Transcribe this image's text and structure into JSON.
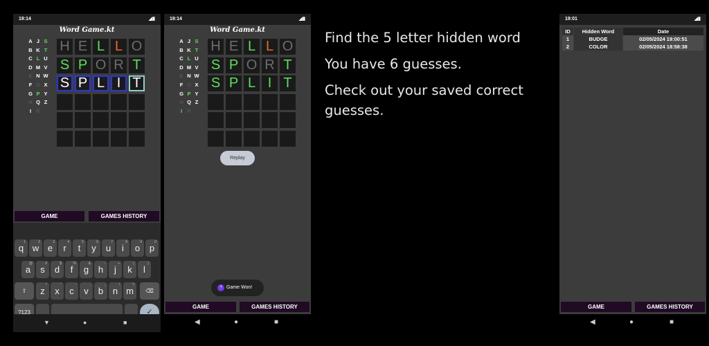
{
  "caption": {
    "line1": "Find the 5 letter hidden word",
    "line2": "You have 6 guesses.",
    "line3a": "Check out your saved correct",
    "line3b": "guesses."
  },
  "phone1": {
    "time": "19:14",
    "title": "Word Game.kt",
    "rows": [
      [
        "H",
        "E",
        "L",
        "L",
        "O"
      ],
      [
        "S",
        "P",
        "O",
        "R",
        "T"
      ],
      [
        "S",
        "P",
        "L",
        "I",
        "T"
      ]
    ],
    "tab_game": "GAME",
    "tab_history": "GAMES HISTORY",
    "keyboard": {
      "row1": [
        "q",
        "w",
        "e",
        "r",
        "t",
        "y",
        "u",
        "i",
        "o",
        "p"
      ],
      "row1_hints": [
        "1",
        "2",
        "3",
        "4",
        "5",
        "6",
        "7",
        "8",
        "9",
        "0"
      ],
      "row2": [
        "a",
        "s",
        "d",
        "f",
        "g",
        "h",
        "j",
        "k",
        "l"
      ],
      "row2_hints": [
        "@",
        "#",
        "$",
        "%",
        "&",
        "-",
        "+",
        "(",
        ")"
      ],
      "row3": [
        "z",
        "x",
        "c",
        "v",
        "b",
        "n",
        "m"
      ],
      "row3_hints": [
        "*",
        "\"",
        "'",
        ":",
        ";",
        "!",
        "?"
      ],
      "shift": "⇧",
      "backspace": "⌫",
      "symbols": "?123",
      "comma": ",",
      "period": ".",
      "enter": "✓"
    }
  },
  "phone2": {
    "time": "19:14",
    "title": "Word Game.kt",
    "rows": [
      [
        "H",
        "E",
        "L",
        "L",
        "O"
      ],
      [
        "S",
        "P",
        "O",
        "R",
        "T"
      ],
      [
        "S",
        "P",
        "L",
        "I",
        "T"
      ]
    ],
    "replay": "Replay",
    "toast": "Game Won!",
    "tab_game": "GAME",
    "tab_history": "GAMES HISTORY"
  },
  "phone3": {
    "time": "19:01",
    "headers": [
      "ID",
      "Hidden Word",
      "Date"
    ],
    "rows": [
      {
        "id": "1",
        "word": "BUDGE",
        "date": "02/05/2024 19:00:51"
      },
      {
        "id": "2",
        "word": "COLOR",
        "date": "02/05/2024 18:58:38"
      }
    ],
    "tab_game": "GAME",
    "tab_history": "GAMES HISTORY"
  },
  "alphabet": [
    {
      "l": "A",
      "c": "w"
    },
    {
      "l": "J",
      "c": "w"
    },
    {
      "l": "S",
      "c": "g"
    },
    {
      "l": "B",
      "c": "w"
    },
    {
      "l": "K",
      "c": "w"
    },
    {
      "l": "T",
      "c": "g"
    },
    {
      "l": "C",
      "c": "w"
    },
    {
      "l": "L",
      "c": "g"
    },
    {
      "l": "U",
      "c": "w"
    },
    {
      "l": "D",
      "c": "w"
    },
    {
      "l": "M",
      "c": "w"
    },
    {
      "l": "V",
      "c": "w"
    },
    {
      "l": "E",
      "c": "x"
    },
    {
      "l": "N",
      "c": "w"
    },
    {
      "l": "W",
      "c": "w"
    },
    {
      "l": "F",
      "c": "w"
    },
    {
      "l": "O",
      "c": "x"
    },
    {
      "l": "X",
      "c": "w"
    },
    {
      "l": "G",
      "c": "w"
    },
    {
      "l": "P",
      "c": "g"
    },
    {
      "l": "Y",
      "c": "w"
    },
    {
      "l": "H",
      "c": "x"
    },
    {
      "l": "Q",
      "c": "w"
    },
    {
      "l": "Z",
      "c": "w"
    },
    {
      "l": "I",
      "c": "w"
    },
    {
      "l": "R",
      "c": "x"
    },
    {
      "l": "",
      "c": "w"
    }
  ],
  "alphabet2": [
    {
      "l": "A",
      "c": "w"
    },
    {
      "l": "J",
      "c": "w"
    },
    {
      "l": "S",
      "c": "g"
    },
    {
      "l": "B",
      "c": "w"
    },
    {
      "l": "K",
      "c": "w"
    },
    {
      "l": "T",
      "c": "g"
    },
    {
      "l": "C",
      "c": "w"
    },
    {
      "l": "L",
      "c": "g"
    },
    {
      "l": "U",
      "c": "w"
    },
    {
      "l": "D",
      "c": "w"
    },
    {
      "l": "M",
      "c": "w"
    },
    {
      "l": "V",
      "c": "w"
    },
    {
      "l": "E",
      "c": "x"
    },
    {
      "l": "N",
      "c": "w"
    },
    {
      "l": "W",
      "c": "w"
    },
    {
      "l": "F",
      "c": "w"
    },
    {
      "l": "O",
      "c": "x"
    },
    {
      "l": "X",
      "c": "w"
    },
    {
      "l": "G",
      "c": "w"
    },
    {
      "l": "P",
      "c": "g"
    },
    {
      "l": "Y",
      "c": "w"
    },
    {
      "l": "H",
      "c": "x"
    },
    {
      "l": "Q",
      "c": "w"
    },
    {
      "l": "Z",
      "c": "w"
    },
    {
      "l": "I",
      "c": "g"
    },
    {
      "l": "R",
      "c": "x"
    },
    {
      "l": "",
      "c": "w"
    }
  ],
  "nav_icons": [
    "back-triangle",
    "home-circle",
    "recents-square"
  ]
}
